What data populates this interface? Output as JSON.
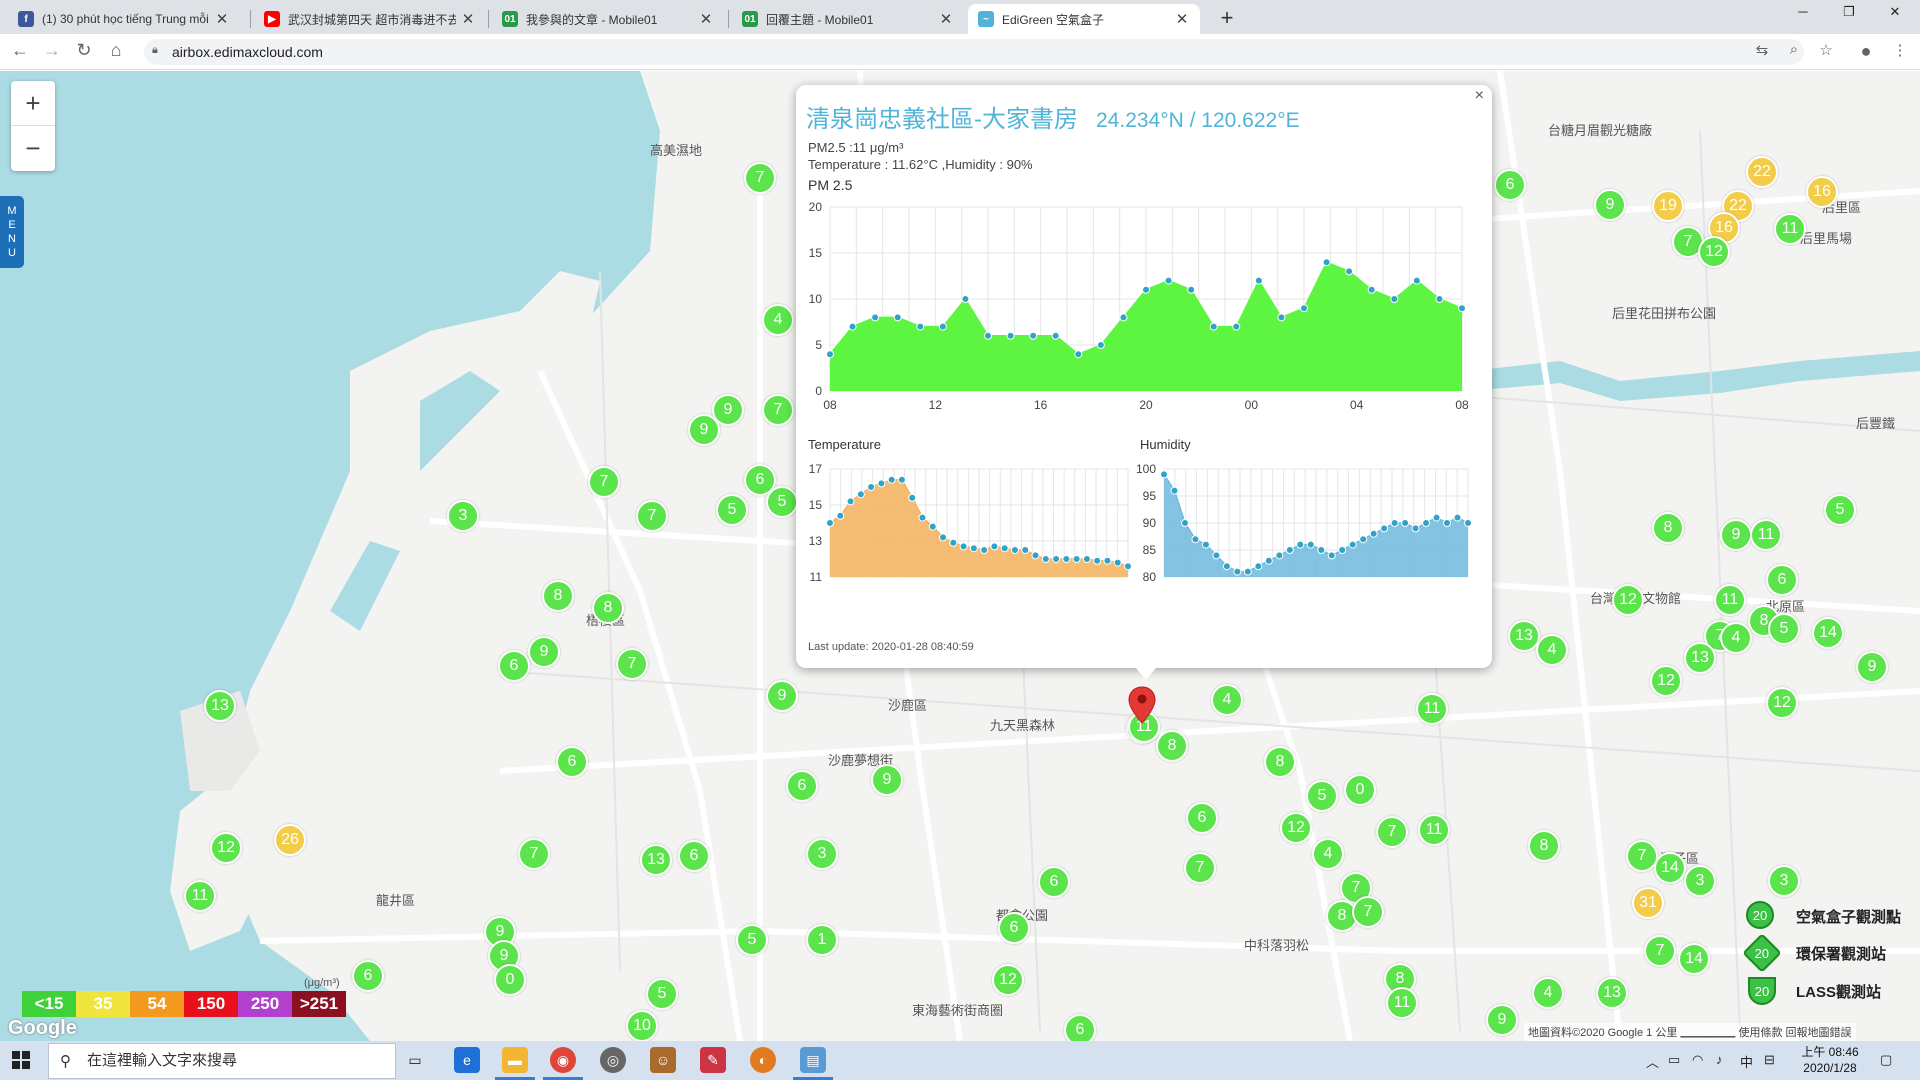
{
  "browser": {
    "tabs": [
      {
        "title": "(1) 30 phút học tiếng Trung mỗi",
        "favicon": "facebook-icon",
        "color": "#3b5998",
        "glyph": "f",
        "active": false
      },
      {
        "title": "武汉封城第四天 超市消毒进不去",
        "favicon": "youtube-icon",
        "color": "#ff0000",
        "glyph": "▶",
        "active": false
      },
      {
        "title": "我參與的文章 - Mobile01",
        "favicon": "mobile01-icon",
        "color": "#2b9a48",
        "glyph": "01",
        "active": false
      },
      {
        "title": "回覆主題 - Mobile01",
        "favicon": "mobile01-icon",
        "color": "#2b9a48",
        "glyph": "01",
        "active": false
      },
      {
        "title": "EdiGreen 空氣盒子",
        "favicon": "edigreen-icon",
        "color": "#4fb4d8",
        "glyph": "~",
        "active": true
      }
    ],
    "url": "airbox.edimaxcloud.com"
  },
  "map": {
    "zoom_in": "+",
    "zoom_out": "−",
    "menu": "MENU",
    "places": [
      {
        "name": "高美濕地",
        "x": 650,
        "y": 140
      },
      {
        "name": "梧棲區",
        "x": 586,
        "y": 610
      },
      {
        "name": "沙鹿區",
        "x": 888,
        "y": 695
      },
      {
        "name": "九天黑森林",
        "x": 990,
        "y": 715
      },
      {
        "name": "沙鹿夢想街",
        "x": 828,
        "y": 750
      },
      {
        "name": "龍井區",
        "x": 376,
        "y": 890
      },
      {
        "name": "都會公園",
        "x": 996,
        "y": 905
      },
      {
        "name": "東海藝術街商圈",
        "x": 912,
        "y": 1000
      },
      {
        "name": "中科落羽松",
        "x": 1244,
        "y": 935
      },
      {
        "name": "潭子區",
        "x": 1660,
        "y": 848
      },
      {
        "name": "北原區",
        "x": 1766,
        "y": 596
      },
      {
        "name": "台灣民俗文物館",
        "x": 1590,
        "y": 588
      },
      {
        "name": "后里區",
        "x": 1822,
        "y": 197
      },
      {
        "name": "后里花田拼布公園",
        "x": 1612,
        "y": 303
      },
      {
        "name": "台糖月眉觀光糖廠",
        "x": 1548,
        "y": 120
      },
      {
        "name": "后里馬場",
        "x": 1800,
        "y": 228
      },
      {
        "name": "后豐鐵",
        "x": 1856,
        "y": 413
      }
    ],
    "legend": {
      "unit": "(μg/m³)",
      "items": [
        {
          "label": "<15",
          "color": "#3fd13a"
        },
        {
          "label": "35",
          "color": "#f0e53c"
        },
        {
          "label": "54",
          "color": "#f39a1e"
        },
        {
          "label": "150",
          "color": "#e8101a"
        },
        {
          "label": "250",
          "color": "#b23fce"
        },
        {
          "label": ">251",
          "color": "#8b1121"
        }
      ]
    },
    "google": "Google",
    "map_legend": [
      {
        "label": "空氣盒子觀測點",
        "value": "20"
      },
      {
        "label": "環保署觀測站",
        "value": "20"
      },
      {
        "label": "LASS觀測站",
        "value": "20"
      }
    ],
    "footer": "地圖資料©2020 Google   1 公里 ▁▁▁▁▁   使用條款   回報地圖錯誤",
    "markers": [
      {
        "v": "7",
        "x": 760,
        "y": 178
      },
      {
        "v": "4",
        "x": 778,
        "y": 320
      },
      {
        "v": "9",
        "x": 728,
        "y": 410
      },
      {
        "v": "9",
        "x": 704,
        "y": 430
      },
      {
        "v": "7",
        "x": 778,
        "y": 410
      },
      {
        "v": "6",
        "x": 760,
        "y": 480
      },
      {
        "v": "5",
        "x": 782,
        "y": 502
      },
      {
        "v": "7",
        "x": 604,
        "y": 482
      },
      {
        "v": "3",
        "x": 463,
        "y": 516
      },
      {
        "v": "7",
        "x": 652,
        "y": 516
      },
      {
        "v": "5",
        "x": 732,
        "y": 510
      },
      {
        "v": "8",
        "x": 558,
        "y": 596
      },
      {
        "v": "8",
        "x": 608,
        "y": 608
      },
      {
        "v": "9",
        "x": 544,
        "y": 652
      },
      {
        "v": "6",
        "x": 514,
        "y": 666
      },
      {
        "v": "7",
        "x": 632,
        "y": 664
      },
      {
        "v": "13",
        "x": 220,
        "y": 706
      },
      {
        "v": "9",
        "x": 782,
        "y": 696
      },
      {
        "v": "6",
        "x": 572,
        "y": 762
      },
      {
        "v": "6",
        "x": 802,
        "y": 786
      },
      {
        "v": "9",
        "x": 887,
        "y": 780
      },
      {
        "v": "12",
        "x": 226,
        "y": 848
      },
      {
        "v": "26",
        "x": 290,
        "y": 840,
        "c": "y"
      },
      {
        "v": "7",
        "x": 534,
        "y": 854
      },
      {
        "v": "13",
        "x": 656,
        "y": 860
      },
      {
        "v": "6",
        "x": 694,
        "y": 856
      },
      {
        "v": "3",
        "x": 822,
        "y": 854
      },
      {
        "v": "11",
        "x": 200,
        "y": 896
      },
      {
        "v": "9",
        "x": 500,
        "y": 932
      },
      {
        "v": "9",
        "x": 504,
        "y": 956
      },
      {
        "v": "0",
        "x": 510,
        "y": 980
      },
      {
        "v": "5",
        "x": 752,
        "y": 940
      },
      {
        "v": "1",
        "x": 822,
        "y": 940
      },
      {
        "v": "6",
        "x": 368,
        "y": 976
      },
      {
        "v": "5",
        "x": 662,
        "y": 994
      },
      {
        "v": "10",
        "x": 642,
        "y": 1026
      },
      {
        "v": "6",
        "x": 1014,
        "y": 928
      },
      {
        "v": "6",
        "x": 1054,
        "y": 882
      },
      {
        "v": "12",
        "x": 1008,
        "y": 980
      },
      {
        "v": "6",
        "x": 1080,
        "y": 1030
      },
      {
        "v": "11",
        "x": 1142,
        "y": 728
      },
      {
        "v": "8",
        "x": 1172,
        "y": 746
      },
      {
        "v": "4",
        "x": 1227,
        "y": 700
      },
      {
        "v": "6",
        "x": 1202,
        "y": 818
      },
      {
        "v": "7",
        "x": 1200,
        "y": 868
      },
      {
        "v": "8",
        "x": 1280,
        "y": 762
      },
      {
        "v": "12",
        "x": 1296,
        "y": 828
      },
      {
        "v": "5",
        "x": 1322,
        "y": 796
      },
      {
        "v": "0",
        "x": 1360,
        "y": 790
      },
      {
        "v": "4",
        "x": 1328,
        "y": 854
      },
      {
        "v": "7",
        "x": 1392,
        "y": 832
      },
      {
        "v": "11",
        "x": 1434,
        "y": 830
      },
      {
        "v": "11",
        "x": 1432,
        "y": 709
      },
      {
        "v": "7",
        "x": 1356,
        "y": 888
      },
      {
        "v": "8",
        "x": 1342,
        "y": 916
      },
      {
        "v": "7",
        "x": 1368,
        "y": 912
      },
      {
        "v": "8",
        "x": 1400,
        "y": 979
      },
      {
        "v": "11",
        "x": 1402,
        "y": 1003
      },
      {
        "v": "4",
        "x": 1548,
        "y": 993
      },
      {
        "v": "13",
        "x": 1612,
        "y": 993
      },
      {
        "v": "9",
        "x": 1502,
        "y": 1020
      },
      {
        "v": "8",
        "x": 1544,
        "y": 846
      },
      {
        "v": "7",
        "x": 1642,
        "y": 856
      },
      {
        "v": "14",
        "x": 1670,
        "y": 868
      },
      {
        "v": "3",
        "x": 1700,
        "y": 881
      },
      {
        "v": "31",
        "x": 1648,
        "y": 903,
        "c": "y"
      },
      {
        "v": "3",
        "x": 1784,
        "y": 881
      },
      {
        "v": "7",
        "x": 1660,
        "y": 951
      },
      {
        "v": "14",
        "x": 1694,
        "y": 959
      },
      {
        "v": "6",
        "x": 1510,
        "y": 185
      },
      {
        "v": "9",
        "x": 1610,
        "y": 205
      },
      {
        "v": "22",
        "x": 1762,
        "y": 172,
        "c": "y"
      },
      {
        "v": "22",
        "x": 1738,
        "y": 206,
        "c": "y"
      },
      {
        "v": "19",
        "x": 1668,
        "y": 206,
        "c": "y"
      },
      {
        "v": "16",
        "x": 1822,
        "y": 192,
        "c": "y"
      },
      {
        "v": "16",
        "x": 1724,
        "y": 228,
        "c": "y"
      },
      {
        "v": "11",
        "x": 1790,
        "y": 229
      },
      {
        "v": "7",
        "x": 1688,
        "y": 242
      },
      {
        "v": "12",
        "x": 1714,
        "y": 252
      },
      {
        "v": "5",
        "x": 1840,
        "y": 510
      },
      {
        "v": "8",
        "x": 1668,
        "y": 528
      },
      {
        "v": "9",
        "x": 1736,
        "y": 535
      },
      {
        "v": "11",
        "x": 1766,
        "y": 535
      },
      {
        "v": "6",
        "x": 1782,
        "y": 580
      },
      {
        "v": "11",
        "x": 1730,
        "y": 600
      },
      {
        "v": "12",
        "x": 1628,
        "y": 600
      },
      {
        "v": "8",
        "x": 1764,
        "y": 621
      },
      {
        "v": "5",
        "x": 1784,
        "y": 629
      },
      {
        "v": "14",
        "x": 1828,
        "y": 633
      },
      {
        "v": "7",
        "x": 1720,
        "y": 636
      },
      {
        "v": "4",
        "x": 1736,
        "y": 638
      },
      {
        "v": "13",
        "x": 1524,
        "y": 636
      },
      {
        "v": "4",
        "x": 1552,
        "y": 650
      },
      {
        "v": "13",
        "x": 1700,
        "y": 658
      },
      {
        "v": "9",
        "x": 1872,
        "y": 667
      },
      {
        "v": "12",
        "x": 1666,
        "y": 681
      },
      {
        "v": "12",
        "x": 1782,
        "y": 703
      },
      {
        "v": "11",
        "x": 1144,
        "y": 727
      }
    ]
  },
  "popup": {
    "title": "清泉崗忠義社區-大家書房",
    "coords": "24.234°N / 120.622°E",
    "pm25_line": "PM2.5 :11 μg/m³",
    "temp_line": "Temperature : 11.62°C ,Humidity : 90%",
    "pm_chart_title": "PM 2.5",
    "temp_title": "Temperature",
    "hum_title": "Humidity",
    "last_update": "Last update: 2020-01-28 08:40:59",
    "close": "×"
  },
  "chart_data": [
    {
      "type": "area",
      "title": "PM 2.5",
      "x_ticks": [
        "08",
        "12",
        "16",
        "20",
        "00",
        "04",
        "08"
      ],
      "ylim": [
        0,
        20
      ],
      "y_ticks": [
        0,
        5,
        10,
        15,
        20
      ],
      "values": [
        4,
        7,
        8,
        8,
        7,
        7,
        10,
        6,
        6,
        6,
        6,
        4,
        5,
        8,
        11,
        12,
        11,
        7,
        7,
        12,
        8,
        9,
        14,
        13,
        11,
        10,
        12,
        10,
        9
      ],
      "color": "#5ef542",
      "grid": true
    },
    {
      "type": "area",
      "title": "Temperature",
      "ylim": [
        11,
        17
      ],
      "y_ticks": [
        11,
        13,
        15,
        17
      ],
      "values": [
        14,
        14.4,
        15.2,
        15.6,
        16,
        16.2,
        16.4,
        16.4,
        15.4,
        14.3,
        13.8,
        13.2,
        12.9,
        12.7,
        12.6,
        12.5,
        12.7,
        12.6,
        12.5,
        12.5,
        12.2,
        12.0,
        12.0,
        12.0,
        12.0,
        12.0,
        11.9,
        11.9,
        11.8,
        11.6
      ],
      "color": "#f3b25c",
      "grid": true
    },
    {
      "type": "area",
      "title": "Humidity",
      "ylim": [
        80,
        100
      ],
      "y_ticks": [
        80,
        85,
        90,
        95,
        100
      ],
      "values": [
        99,
        96,
        90,
        87,
        86,
        84,
        82,
        81,
        81,
        82,
        83,
        84,
        85,
        86,
        86,
        85,
        84,
        85,
        86,
        87,
        88,
        89,
        90,
        90,
        89,
        90,
        91,
        90,
        91,
        90
      ],
      "color": "#6fb9dd",
      "grid": true
    }
  ],
  "taskbar": {
    "search_placeholder": "在這裡輸入文字來搜尋",
    "time": "上午 08:46",
    "date": "2020/1/28",
    "ime": "中"
  }
}
